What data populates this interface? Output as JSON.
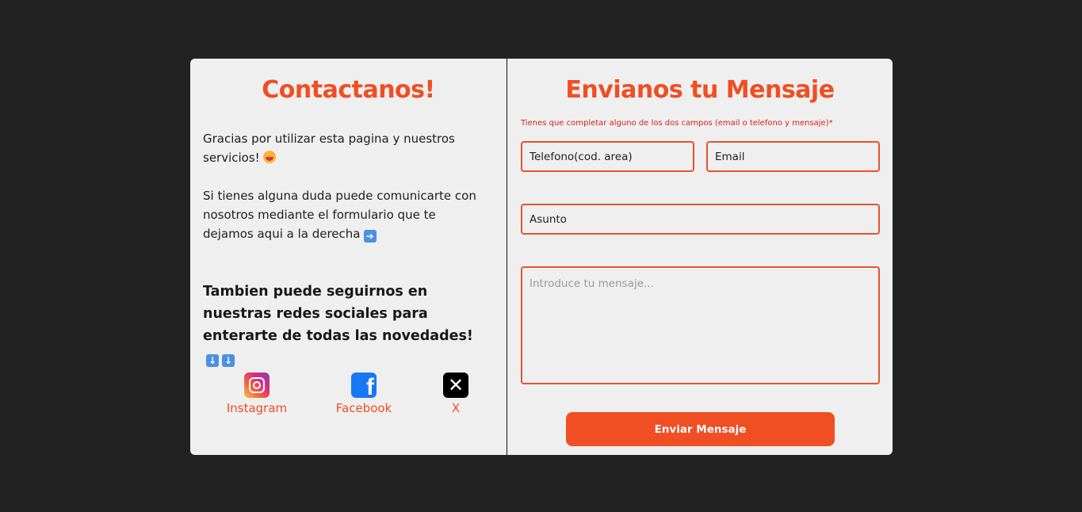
{
  "left": {
    "title": "Contactanos!",
    "paragraph1": "Gracias por utilizar esta pagina y nuestros servicios!",
    "paragraph2": "Si tienes alguna duda puede comunicarte con nosotros mediante el formulario que te dejamos aqui a la derecha",
    "paragraph3": "Tambien puede seguirnos en nuestras redes sociales para enterarte de todas las novedades!",
    "socials": [
      {
        "label": "Instagram",
        "icon": "instagram-icon"
      },
      {
        "label": "Facebook",
        "icon": "facebook-icon"
      },
      {
        "label": "X",
        "icon": "x-icon"
      }
    ]
  },
  "right": {
    "title": "Envianos tu Mensaje",
    "hint": "Tienes que completar alguno de los dos campos (email o telefono y mensaje)*",
    "phone_value": "Telefono(cod. area)",
    "email_value": "Email",
    "subject_value": "Asunto",
    "message_placeholder": "Introduce tu mensaje...",
    "submit_label": "Enviar Mensaje"
  },
  "colors": {
    "accent": "#f04e23",
    "background": "#222222",
    "card": "#efefef",
    "hint": "#d81e1e"
  }
}
